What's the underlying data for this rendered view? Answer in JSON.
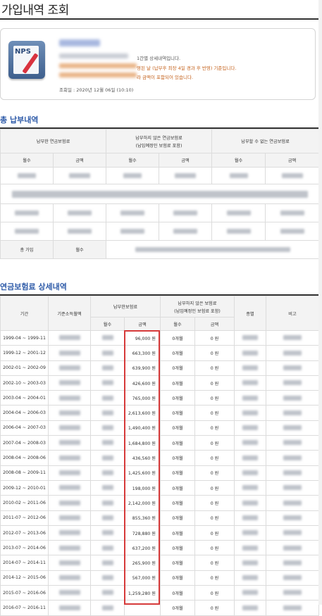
{
  "page": {
    "title": "가입내역 조회"
  },
  "info": {
    "logo_text": "NPS",
    "line1": "1간별 상세내역입니다.",
    "line2": "영된 날 (납부후 최장 4일 경과 후 반영) 기준입니다.",
    "line3": "라 금액이 포함되어 있습니다.",
    "date": "조회일 : 2020년 12월 06일 (10:10)"
  },
  "summary": {
    "title": "총 납부내역",
    "headers": {
      "paid": "납부한 연금보험료",
      "unpaid_line1": "납부하지 않은 연금보험료",
      "unpaid_line2": "(납입예정인 보험료 포함)",
      "cannot": "납부할 수 없는 연금보험료",
      "months": "월수",
      "amount": "금액"
    },
    "total_label": "총 가입",
    "total_months_label": "월수"
  },
  "detail": {
    "title": "연금보험료 상세내역",
    "headers": {
      "period": "기간",
      "base_income": "기준소득월액",
      "paid": "납부한보험료",
      "unpaid_line1": "납부하지 않은 보험료",
      "unpaid_line2": "(납입예정인 보험료 포함)",
      "type": "종별",
      "note": "비고",
      "months": "월수",
      "amount": "금액"
    },
    "rows": [
      {
        "period": "1999-04 ~ 1999-11",
        "amount": "96,000 원",
        "unpaid_months": "0개월",
        "unpaid_amount": "0 원"
      },
      {
        "period": "1999-12 ~ 2001-12",
        "amount": "663,300 원",
        "unpaid_months": "0개월",
        "unpaid_amount": "0 원"
      },
      {
        "period": "2002-01 ~ 2002-09",
        "amount": "639,900 원",
        "unpaid_months": "0개월",
        "unpaid_amount": "0 원"
      },
      {
        "period": "2002-10 ~ 2003-03",
        "amount": "426,600 원",
        "unpaid_months": "0개월",
        "unpaid_amount": "0 원"
      },
      {
        "period": "2003-04 ~ 2004-01",
        "amount": "765,000 원",
        "unpaid_months": "0개월",
        "unpaid_amount": "0 원"
      },
      {
        "period": "2004-04 ~ 2006-03",
        "amount": "2,613,600 원",
        "unpaid_months": "0개월",
        "unpaid_amount": "0 원"
      },
      {
        "period": "2006-04 ~ 2007-03",
        "amount": "1,490,400 원",
        "unpaid_months": "0개월",
        "unpaid_amount": "0 원"
      },
      {
        "period": "2007-04 ~ 2008-03",
        "amount": "1,684,800 원",
        "unpaid_months": "0개월",
        "unpaid_amount": "0 원"
      },
      {
        "period": "2008-04 ~ 2008-06",
        "amount": "436,560 원",
        "unpaid_months": "0개월",
        "unpaid_amount": "0 원"
      },
      {
        "period": "2008-08 ~ 2009-11",
        "amount": "1,425,600 원",
        "unpaid_months": "0개월",
        "unpaid_amount": "0 원"
      },
      {
        "period": "2009-12 ~ 2010-01",
        "amount": "198,000 원",
        "unpaid_months": "0개월",
        "unpaid_amount": "0 원"
      },
      {
        "period": "2010-02 ~ 2011-06",
        "amount": "2,142,000 원",
        "unpaid_months": "0개월",
        "unpaid_amount": "0 원"
      },
      {
        "period": "2011-07 ~ 2012-06",
        "amount": "855,360 원",
        "unpaid_months": "0개월",
        "unpaid_amount": "0 원"
      },
      {
        "period": "2012-07 ~ 2013-06",
        "amount": "728,880 원",
        "unpaid_months": "0개월",
        "unpaid_amount": "0 원"
      },
      {
        "period": "2013-07 ~ 2014-06",
        "amount": "637,200 원",
        "unpaid_months": "0개월",
        "unpaid_amount": "0 원"
      },
      {
        "period": "2014-07 ~ 2014-11",
        "amount": "265,900 원",
        "unpaid_months": "0개월",
        "unpaid_amount": "0 원"
      },
      {
        "period": "2014-12 ~ 2015-06",
        "amount": "567,000 원",
        "unpaid_months": "0개월",
        "unpaid_amount": "0 원"
      },
      {
        "period": "2015-07 ~ 2016-06",
        "amount": "1,259,280 원",
        "unpaid_months": "0개월",
        "unpaid_amount": "0 원"
      },
      {
        "period": "2016-07 ~ 2016-11",
        "amount": "",
        "unpaid_months": "0개월",
        "unpaid_amount": "0 원"
      }
    ]
  },
  "colors": {
    "accent": "#2d5aa8",
    "highlight": "#d63a3a",
    "header_bg": "#f3f3f3"
  }
}
